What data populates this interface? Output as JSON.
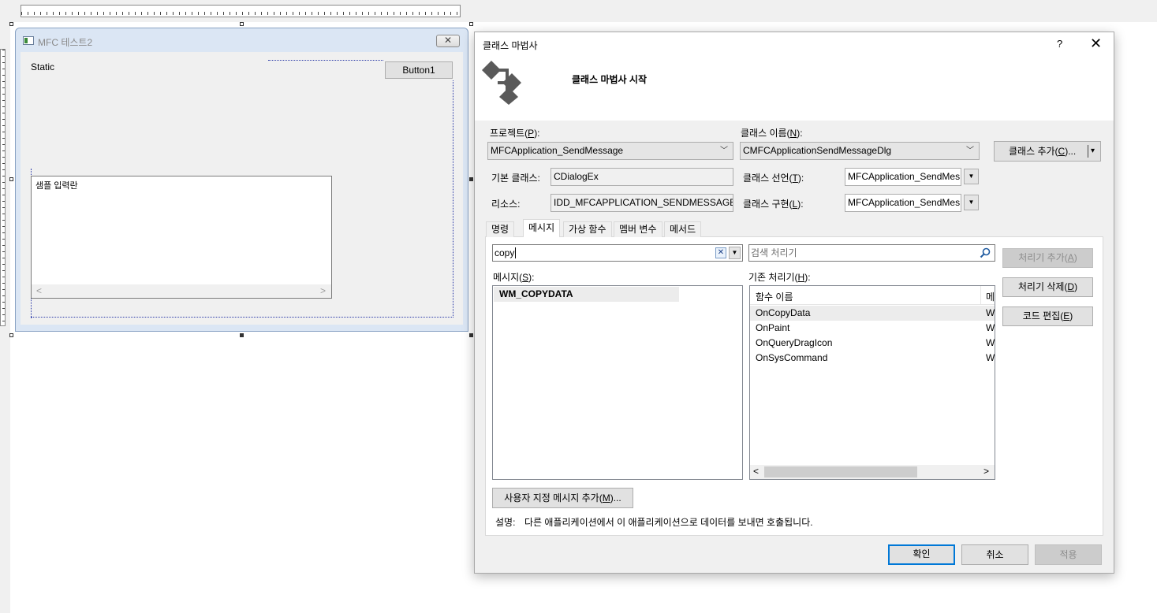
{
  "designer": {
    "window_title": "MFC 테스트2",
    "close_glyph": "✕",
    "static_label": "Static",
    "button1_label": "Button1",
    "edit_text": "샘플 입력란"
  },
  "wizard": {
    "title": "클래스 마법사",
    "help_glyph": "?",
    "close_glyph": "✕",
    "subtitle": "클래스 마법사 시작",
    "project": {
      "label": "프로젝트(",
      "hotkey": "P",
      "label_end": "):",
      "value": "MFCApplication_SendMessage"
    },
    "class_name": {
      "label": "클래스 이름(",
      "hotkey": "N",
      "label_end": "):",
      "value": "CMFCApplicationSendMessageDlg"
    },
    "add_class_button": {
      "label": "클래스 추가(",
      "hotkey": "C",
      "label_end": ")...",
      "arrow": "▾"
    },
    "base_class": {
      "label": "기본 클래스:",
      "value": "CDialogEx"
    },
    "class_decl": {
      "label": "클래스 선언(",
      "hotkey": "T",
      "label_end": "):",
      "value": "MFCApplication_SendMes"
    },
    "resource": {
      "label": "리소스:",
      "value": "IDD_MFCAPPLICATION_SENDMESSAGE_D"
    },
    "class_impl": {
      "label": "클래스 구현(",
      "hotkey": "L",
      "label_end": "):",
      "value": "MFCApplication_SendMes"
    },
    "tabs": [
      {
        "label": "명령"
      },
      {
        "label": "메시지"
      },
      {
        "label": "가상 함수"
      },
      {
        "label": "멤버 변수"
      },
      {
        "label": "메서드"
      }
    ],
    "active_tab": "메시지",
    "message_search": {
      "value": "copy",
      "clear_glyph": "✕"
    },
    "handler_search": {
      "placeholder": "검색 처리기"
    },
    "messages": {
      "label": "메시지(",
      "hotkey": "S",
      "label_end": "):",
      "items": [
        "WM_COPYDATA"
      ]
    },
    "handlers": {
      "label": "기존 처리기(",
      "hotkey": "H",
      "label_end": "):",
      "column_function": "함수 이름",
      "column_message": "메",
      "rows": [
        {
          "function": "OnCopyData",
          "message": "W"
        },
        {
          "function": "OnPaint",
          "message": "W"
        },
        {
          "function": "OnQueryDragIcon",
          "message": "W"
        },
        {
          "function": "OnSysCommand",
          "message": "W"
        }
      ]
    },
    "add_handler_button": {
      "label": "처리기 추가(",
      "hotkey": "A",
      "label_end": ")"
    },
    "delete_handler_button": {
      "label": "처리기 삭제(",
      "hotkey": "D",
      "label_end": ")"
    },
    "edit_code_button": {
      "label": "코드 편집(",
      "hotkey": "E",
      "label_end": ")"
    },
    "custom_message_button": {
      "label": "사용자 지정 메시지 추가(",
      "hotkey": "M",
      "label_end": ")..."
    },
    "description": {
      "label": "설명:",
      "text": "다른 애플리케이션에서 이 애플리케이션으로 데이터를 보내면 호출됩니다."
    },
    "ok_button": "확인",
    "cancel_button": "취소",
    "apply_button": "적용"
  }
}
